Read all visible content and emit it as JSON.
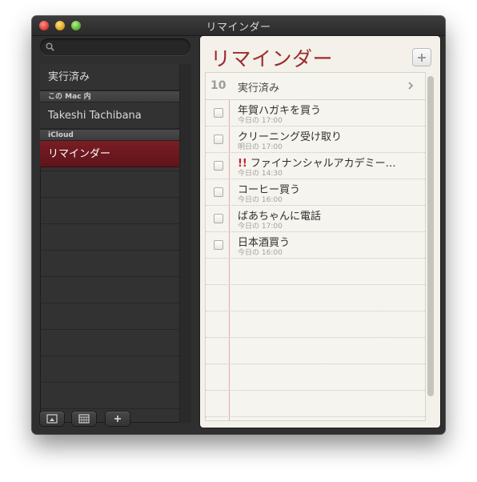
{
  "window": {
    "title": "リマインダー"
  },
  "sidebar": {
    "search_placeholder": "",
    "completed_label": "実行済み",
    "section_mac": "この Mac 内",
    "account_name": "Takeshi Tachibana",
    "section_icloud": "iCloud",
    "selected_list": "リマインダー"
  },
  "icons": {
    "search": "search-icon",
    "show_info": "info-panel-icon",
    "calendar": "calendar-icon",
    "add_list": "plus-icon",
    "add_reminder": "plus-icon",
    "completed_chevron": "chevron-right-icon"
  },
  "main": {
    "title": "リマインダー",
    "completed": {
      "count": "10",
      "label": "実行済み"
    },
    "items": [
      {
        "title": "年賀ハガキを買う",
        "due": "今日の 17:00",
        "priority": ""
      },
      {
        "title": "クリーニング受け取り",
        "due": "明日の 17:00",
        "priority": ""
      },
      {
        "title": "ファイナンシャルアカデミー…",
        "due": "今日の 14:30",
        "priority": "!!"
      },
      {
        "title": "コーヒー買う",
        "due": "今日の 16:00",
        "priority": ""
      },
      {
        "title": "ばあちゃんに電話",
        "due": "今日の 17:00",
        "priority": ""
      },
      {
        "title": "日本酒買う",
        "due": "今日の 16:00",
        "priority": ""
      }
    ]
  },
  "colors": {
    "accent_red": "#9d2b2b",
    "selection": "#6b1920",
    "paper": "#f3f1ea",
    "priority": "#c0262c"
  }
}
